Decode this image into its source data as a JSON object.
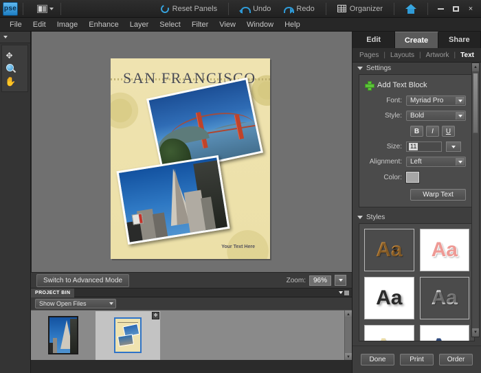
{
  "app": {
    "logo_text": "pse",
    "layout_icon": "layout-grid-icon"
  },
  "topbar": {
    "reset_panels": "Reset Panels",
    "undo": "Undo",
    "redo": "Redo",
    "organizer": "Organizer",
    "home_icon": "home-icon",
    "minimize": "",
    "maximize": "",
    "close": "×"
  },
  "menubar": {
    "items": [
      {
        "label": "File"
      },
      {
        "label": "Edit"
      },
      {
        "label": "Image"
      },
      {
        "label": "Enhance"
      },
      {
        "label": "Layer"
      },
      {
        "label": "Select"
      },
      {
        "label": "Filter"
      },
      {
        "label": "View"
      },
      {
        "label": "Window"
      },
      {
        "label": "Help"
      }
    ]
  },
  "tools": {
    "move": "move-tool",
    "zoom": "zoom-tool",
    "hand": "hand-tool"
  },
  "document": {
    "title": "SAN FRANCISCO",
    "footer_text": "Your Text Here",
    "photo1": "golden-gate-bridge-photo",
    "photo2": "transamerica-pyramid-photo"
  },
  "statusbar": {
    "advanced_mode": "Switch to Advanced Mode",
    "zoom_label": "Zoom:",
    "zoom_value": "96%"
  },
  "project_bin": {
    "title": "PROJECT BIN",
    "filter_value": "Show Open Files",
    "items": [
      {
        "name": "city-photo-thumbnail"
      },
      {
        "name": "collage-document-thumbnail",
        "selected": true
      }
    ]
  },
  "right_panel": {
    "tabs": [
      {
        "label": "Edit",
        "active": false
      },
      {
        "label": "Create",
        "active": true
      },
      {
        "label": "Share",
        "active": false
      }
    ],
    "subtabs": [
      {
        "label": "Pages",
        "active": false
      },
      {
        "label": "Layouts",
        "active": false
      },
      {
        "label": "Artwork",
        "active": false
      },
      {
        "label": "Text",
        "active": true
      }
    ],
    "settings": {
      "section_title": "Settings",
      "add_text_block": "Add Text Block",
      "font_label": "Font:",
      "font_value": "Myriad Pro",
      "style_label": "Style:",
      "style_value": "Bold",
      "bold_btn": "B",
      "italic_btn": "I",
      "underline_btn": "U",
      "size_label": "Size:",
      "size_value": "11",
      "alignment_label": "Alignment:",
      "alignment_value": "Left",
      "color_label": "Color:",
      "color_value": "#a6a6a6",
      "warp_text": "Warp Text"
    },
    "styles": {
      "section_title": "Styles",
      "thumbnails": [
        {
          "label": "Aa",
          "name": "style-leopard"
        },
        {
          "label": "Aa",
          "name": "style-pink"
        },
        {
          "label": "Aa",
          "name": "style-black-grunge"
        },
        {
          "label": "Aa",
          "name": "style-chrome"
        },
        {
          "label": "Aa",
          "name": "style-cream"
        },
        {
          "label": "Aa",
          "name": "style-denim"
        }
      ]
    },
    "footer": {
      "done": "Done",
      "print": "Print",
      "order": "Order"
    }
  }
}
